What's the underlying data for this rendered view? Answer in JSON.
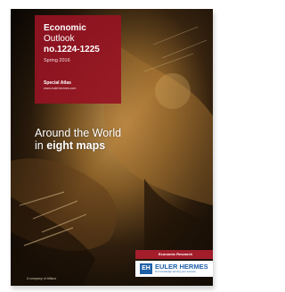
{
  "cover": {
    "red_box": {
      "line1": "Economic",
      "line2": "Outlook",
      "line3": "no.1224-1225",
      "date": "Spring 2016",
      "type": "Special Atlas",
      "url": "www.eulerhermes.com"
    },
    "headline": {
      "line1": "Around the World",
      "line2_prefix": "in ",
      "line2_bold": "eight maps"
    },
    "research_label": "Economic Research",
    "logo": {
      "mark": "EH",
      "name": "EULER HERMES",
      "tagline": "Our knowledge serving your success"
    },
    "allianz_text": "A company of Allianz"
  }
}
